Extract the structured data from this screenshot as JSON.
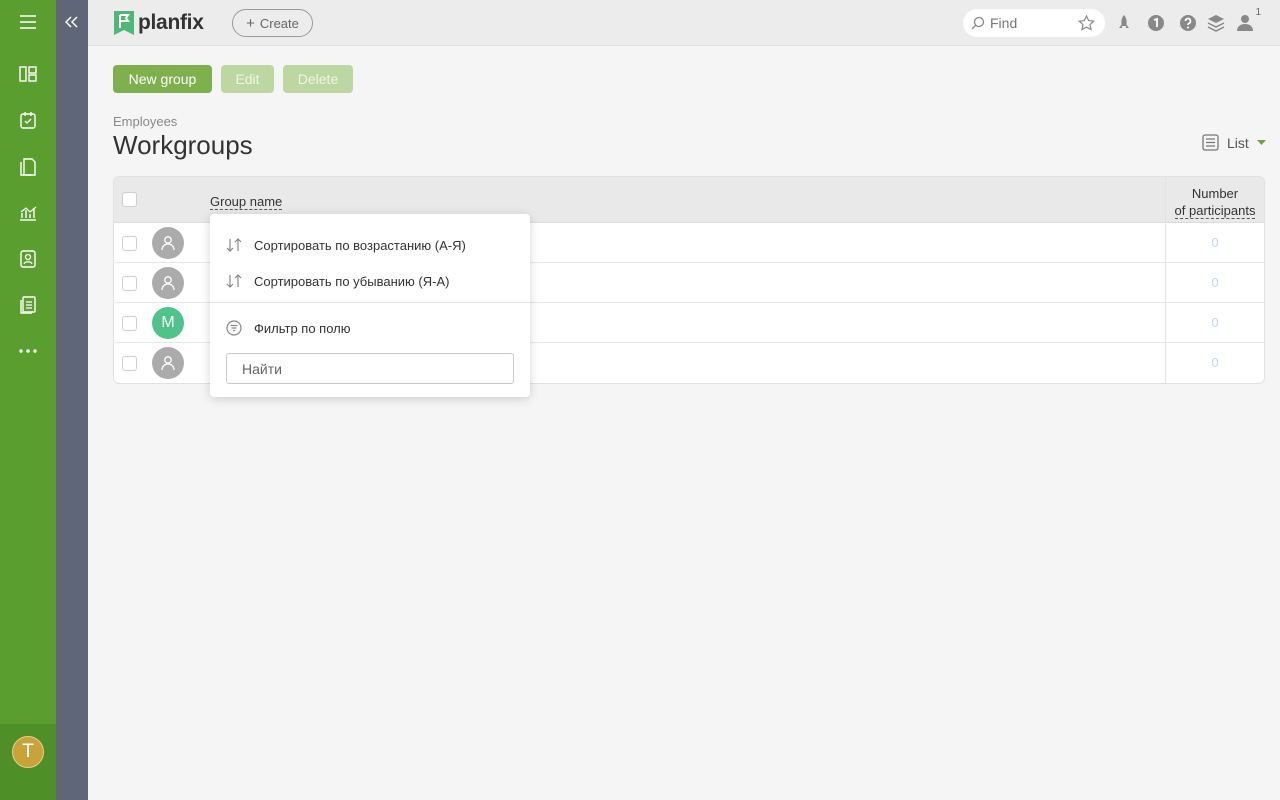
{
  "app": {
    "logo_text": "planfix",
    "create_label": "Create"
  },
  "header": {
    "search_placeholder": "Find",
    "notification_count": "1"
  },
  "user": {
    "initial": "T"
  },
  "toolbar": {
    "new_group_label": "New group",
    "edit_label": "Edit",
    "delete_label": "Delete"
  },
  "page": {
    "breadcrumb": "Employees",
    "title": "Workgroups",
    "view_label": "List"
  },
  "table": {
    "col_group_name": "Group name",
    "col_participants_line1": "Number",
    "col_participants_line2": "of participants",
    "rows": [
      {
        "avatar": "user-icon",
        "initial": "",
        "participants": "0"
      },
      {
        "avatar": "user-icon",
        "initial": "",
        "participants": "0"
      },
      {
        "avatar": "letter",
        "initial": "M",
        "participants": "0"
      },
      {
        "avatar": "user-icon",
        "initial": "",
        "participants": "0"
      }
    ]
  },
  "dropdown": {
    "sort_asc": "Сортировать по возрастанию (А-Я)",
    "sort_desc": "Сортировать по убыванию (Я-А)",
    "filter": "Фильтр по полю",
    "search_placeholder": "Найти"
  },
  "colors": {
    "sidebar": "#5a9e2f",
    "strip": "#5e6677",
    "primary_button": "#7fb04e",
    "disabled_button": "#bcd7a2",
    "avatar_green": "#4fc38a"
  }
}
